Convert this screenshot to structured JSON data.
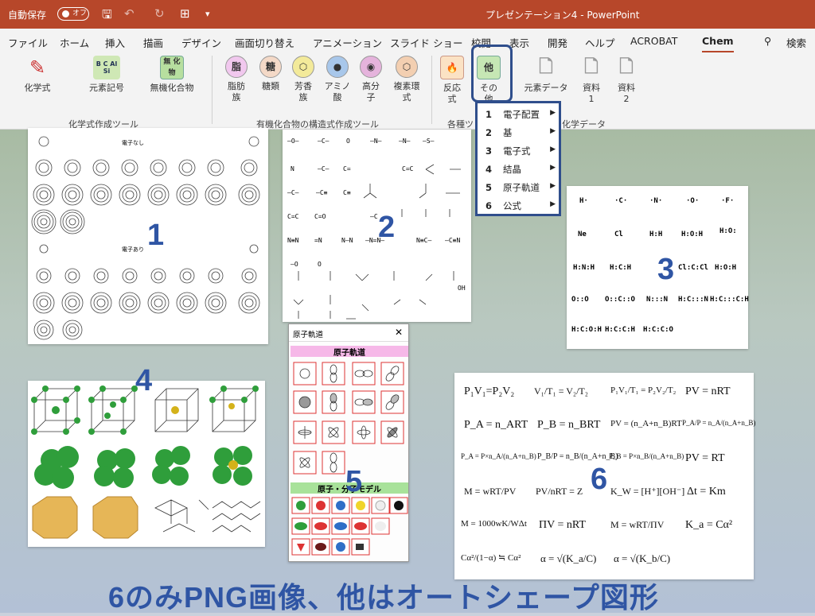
{
  "titlebar": {
    "autosave": "自動保存",
    "toggle": "オフ",
    "title": "プレゼンテーション4 - PowerPoint"
  },
  "tabs": [
    "ファイル",
    "ホーム",
    "挿入",
    "描画",
    "デザイン",
    "画面切り替え",
    "アニメーション",
    "スライド ショー",
    "校閲",
    "表示",
    "開発",
    "ヘルプ",
    "ACROBAT",
    "Chem",
    "検索"
  ],
  "ribbon": {
    "b1": "化学式",
    "b2": "元素記号",
    "b3": "無機化合物",
    "b4a": "脂肪",
    "b4b": "族",
    "b5": "糖類",
    "b6a": "芳香",
    "b6b": "族",
    "b7a": "アミノ",
    "b7b": "酸",
    "b8a": "高分",
    "b8b": "子",
    "b9a": "複素環",
    "b9b": "式",
    "b10a": "反応",
    "b10b": "式",
    "b11a": "その",
    "b11b": "他",
    "b12": "元素データ",
    "b13a": "資料",
    "b13b": "1",
    "b14a": "資料",
    "b14b": "2",
    "icon_b2": "B C Al Si",
    "icon_b3": "無 化物",
    "icon_b4": "脂",
    "icon_b5": "糖",
    "icon_b11": "他",
    "g1": "化学式作成ツール",
    "g2": "有機化合物の構造式作成ツール",
    "g3": "各種ツ",
    "g4": "化学データ"
  },
  "menu": [
    {
      "num": "1",
      "label": "電子配置"
    },
    {
      "num": "2",
      "label": "基"
    },
    {
      "num": "3",
      "label": "電子式"
    },
    {
      "num": "4",
      "label": "結晶"
    },
    {
      "num": "5",
      "label": "原子軌道"
    },
    {
      "num": "6",
      "label": "公式"
    }
  ],
  "panel1": {
    "label_top": "電子なし",
    "label_mid": "電子あり",
    "num": "1"
  },
  "panel2": {
    "num": "2",
    "frags": [
      "—O—",
      "—C—",
      "O",
      "—N—",
      "—N—",
      "—S—",
      "N",
      "—C—",
      "C=",
      "C=C",
      "—C—",
      "—C≡",
      "C≡",
      "C=O",
      "—C",
      "N≡N",
      "=N",
      "N—N",
      "—N=N—",
      "N≡C—",
      "—C≡N",
      "—O",
      "O",
      "OH"
    ]
  },
  "panel3": {
    "num": "3",
    "items": [
      "H·",
      "·C·",
      "·N·",
      "·O·",
      "·F·",
      "Ne",
      "Cl",
      "H:H",
      "H:O:H",
      "H:O:",
      "H:N:H",
      "H:C:H",
      "Cl:C:Cl",
      "H:O:H",
      "O::O",
      "O::C::O",
      "N:::N",
      "H:C:::N",
      "H:C:::C:H",
      "H:C:O:H",
      "H:C:C:H",
      "H:C:C:O"
    ]
  },
  "panel4": {
    "num": "4"
  },
  "panel5": {
    "title": "原子軌道",
    "close": "✕",
    "h1": "原子軌道",
    "h2": "原子・分子モデル",
    "num": "5"
  },
  "panel6": {
    "num": "6",
    "formulas": [
      "P₁V₁=P₂V₂",
      "V₁/T₁ = V₂/T₂",
      "P₁V₁/T₁ = P₂V₂/T₂",
      "PV = nRT",
      "P_A = n_ART",
      "P_B = n_BRT",
      "PV = (n_A+n_B)RT",
      "P_A/P = n_A/(n_A+n_B)",
      "P_A = P×n_A/(n_A+n_B)",
      "P_B/P = n_B/(n_A+n_B)",
      "P_B = P×n_B/(n_A+n_B)",
      "PV = RT",
      "M = wRT/PV",
      "PV/nRT = Z",
      "K_W = [H⁺][OH⁻]",
      "Δt = Km",
      "M = 1000wK/WΔt",
      "ΠV = nRT",
      "M = wRT/ΠV",
      "K_a = Cα²",
      "Cα²/(1−α) ≒ Cα²",
      "α = √(K_a/C)",
      "α = √(K_b/C)"
    ]
  },
  "caption": "6のみPNG画像、他はオートシェープ図形"
}
